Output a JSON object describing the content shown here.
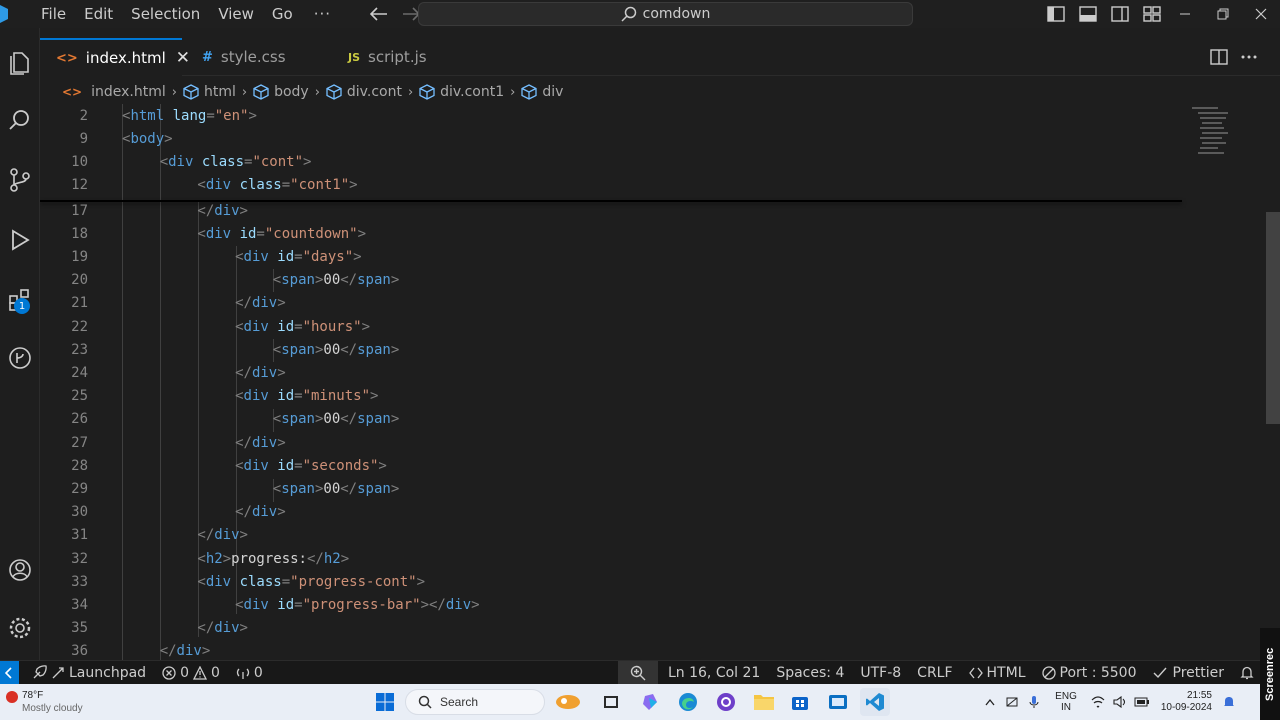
{
  "titlebar": {
    "menu": [
      "File",
      "Edit",
      "Selection",
      "View",
      "Go"
    ],
    "more": "···",
    "command_center": "comdown"
  },
  "tabs": [
    {
      "label": "index.html",
      "icon": "<>",
      "active": true
    },
    {
      "label": "style.css",
      "icon": "#",
      "active": false
    },
    {
      "label": "script.js",
      "icon": "JS",
      "active": false
    }
  ],
  "breadcrumb": [
    "index.html",
    "html",
    "body",
    "div.cont",
    "div.cont1",
    "div"
  ],
  "activity_badge": "1",
  "editor": {
    "sticky": [
      {
        "n": "2",
        "indent": 0,
        "code": [
          [
            "br",
            "<"
          ],
          [
            "tag",
            "html"
          ],
          [
            "txt",
            " "
          ],
          [
            "attr",
            "lang"
          ],
          [
            "br",
            "="
          ],
          [
            "str",
            "\"en\""
          ],
          [
            "br",
            ">"
          ]
        ]
      },
      {
        "n": "9",
        "indent": 0,
        "code": [
          [
            "br",
            "<"
          ],
          [
            "tag",
            "body"
          ],
          [
            "br",
            ">"
          ]
        ]
      },
      {
        "n": "10",
        "indent": 1,
        "code": [
          [
            "br",
            "<"
          ],
          [
            "tag",
            "div"
          ],
          [
            "txt",
            " "
          ],
          [
            "attr",
            "class"
          ],
          [
            "br",
            "="
          ],
          [
            "str",
            "\"cont\""
          ],
          [
            "br",
            ">"
          ]
        ]
      },
      {
        "n": "12",
        "indent": 2,
        "code": [
          [
            "br",
            "<"
          ],
          [
            "tag",
            "div"
          ],
          [
            "txt",
            " "
          ],
          [
            "attr",
            "class"
          ],
          [
            "br",
            "="
          ],
          [
            "str",
            "\"cont1\""
          ],
          [
            "br",
            ">"
          ]
        ]
      }
    ],
    "lines": [
      {
        "n": "17",
        "indent": 2,
        "code": [
          [
            "br",
            "</"
          ],
          [
            "tag",
            "div"
          ],
          [
            "br",
            ">"
          ]
        ]
      },
      {
        "n": "18",
        "indent": 2,
        "code": [
          [
            "br",
            "<"
          ],
          [
            "tag",
            "div"
          ],
          [
            "txt",
            " "
          ],
          [
            "attr",
            "id"
          ],
          [
            "br",
            "="
          ],
          [
            "str",
            "\"countdown\""
          ],
          [
            "br",
            ">"
          ]
        ]
      },
      {
        "n": "19",
        "indent": 3,
        "code": [
          [
            "br",
            "<"
          ],
          [
            "tag",
            "div"
          ],
          [
            "txt",
            " "
          ],
          [
            "attr",
            "id"
          ],
          [
            "br",
            "="
          ],
          [
            "str",
            "\"days\""
          ],
          [
            "br",
            ">"
          ]
        ]
      },
      {
        "n": "20",
        "indent": 4,
        "code": [
          [
            "br",
            "<"
          ],
          [
            "tag",
            "span"
          ],
          [
            "br",
            ">"
          ],
          [
            "txt",
            "00"
          ],
          [
            "br",
            "</"
          ],
          [
            "tag",
            "span"
          ],
          [
            "br",
            ">"
          ]
        ]
      },
      {
        "n": "21",
        "indent": 3,
        "code": [
          [
            "br",
            "</"
          ],
          [
            "tag",
            "div"
          ],
          [
            "br",
            ">"
          ]
        ]
      },
      {
        "n": "22",
        "indent": 3,
        "code": [
          [
            "br",
            "<"
          ],
          [
            "tag",
            "div"
          ],
          [
            "txt",
            " "
          ],
          [
            "attr",
            "id"
          ],
          [
            "br",
            "="
          ],
          [
            "str",
            "\"hours\""
          ],
          [
            "br",
            ">"
          ]
        ]
      },
      {
        "n": "23",
        "indent": 4,
        "code": [
          [
            "br",
            "<"
          ],
          [
            "tag",
            "span"
          ],
          [
            "br",
            ">"
          ],
          [
            "txt",
            "00"
          ],
          [
            "br",
            "</"
          ],
          [
            "tag",
            "span"
          ],
          [
            "br",
            ">"
          ]
        ]
      },
      {
        "n": "24",
        "indent": 3,
        "code": [
          [
            "br",
            "</"
          ],
          [
            "tag",
            "div"
          ],
          [
            "br",
            ">"
          ]
        ]
      },
      {
        "n": "25",
        "indent": 3,
        "code": [
          [
            "br",
            "<"
          ],
          [
            "tag",
            "div"
          ],
          [
            "txt",
            " "
          ],
          [
            "attr",
            "id"
          ],
          [
            "br",
            "="
          ],
          [
            "str",
            "\"minuts\""
          ],
          [
            "br",
            ">"
          ]
        ]
      },
      {
        "n": "26",
        "indent": 4,
        "code": [
          [
            "br",
            "<"
          ],
          [
            "tag",
            "span"
          ],
          [
            "br",
            ">"
          ],
          [
            "txt",
            "00"
          ],
          [
            "br",
            "</"
          ],
          [
            "tag",
            "span"
          ],
          [
            "br",
            ">"
          ]
        ]
      },
      {
        "n": "27",
        "indent": 3,
        "code": [
          [
            "br",
            "</"
          ],
          [
            "tag",
            "div"
          ],
          [
            "br",
            ">"
          ]
        ]
      },
      {
        "n": "28",
        "indent": 3,
        "code": [
          [
            "br",
            "<"
          ],
          [
            "tag",
            "div"
          ],
          [
            "txt",
            " "
          ],
          [
            "attr",
            "id"
          ],
          [
            "br",
            "="
          ],
          [
            "str",
            "\"seconds\""
          ],
          [
            "br",
            ">"
          ]
        ]
      },
      {
        "n": "29",
        "indent": 4,
        "code": [
          [
            "br",
            "<"
          ],
          [
            "tag",
            "span"
          ],
          [
            "br",
            ">"
          ],
          [
            "txt",
            "00"
          ],
          [
            "br",
            "</"
          ],
          [
            "tag",
            "span"
          ],
          [
            "br",
            ">"
          ]
        ]
      },
      {
        "n": "30",
        "indent": 3,
        "code": [
          [
            "br",
            "</"
          ],
          [
            "tag",
            "div"
          ],
          [
            "br",
            ">"
          ]
        ]
      },
      {
        "n": "31",
        "indent": 2,
        "code": [
          [
            "br",
            "</"
          ],
          [
            "tag",
            "div"
          ],
          [
            "br",
            ">"
          ]
        ]
      },
      {
        "n": "32",
        "indent": 2,
        "code": [
          [
            "br",
            "<"
          ],
          [
            "tag",
            "h2"
          ],
          [
            "br",
            ">"
          ],
          [
            "txt",
            "progress:"
          ],
          [
            "br",
            "</"
          ],
          [
            "tag",
            "h2"
          ],
          [
            "br",
            ">"
          ]
        ]
      },
      {
        "n": "33",
        "indent": 2,
        "code": [
          [
            "br",
            "<"
          ],
          [
            "tag",
            "div"
          ],
          [
            "txt",
            " "
          ],
          [
            "attr",
            "class"
          ],
          [
            "br",
            "="
          ],
          [
            "str",
            "\"progress-cont\""
          ],
          [
            "br",
            ">"
          ]
        ]
      },
      {
        "n": "34",
        "indent": 3,
        "code": [
          [
            "br",
            "<"
          ],
          [
            "tag",
            "div"
          ],
          [
            "txt",
            " "
          ],
          [
            "attr",
            "id"
          ],
          [
            "br",
            "="
          ],
          [
            "str",
            "\"progress-bar\""
          ],
          [
            "br",
            "></"
          ],
          [
            "tag",
            "div"
          ],
          [
            "br",
            ">"
          ]
        ]
      },
      {
        "n": "35",
        "indent": 2,
        "code": [
          [
            "br",
            "</"
          ],
          [
            "tag",
            "div"
          ],
          [
            "br",
            ">"
          ]
        ]
      },
      {
        "n": "36",
        "indent": 1,
        "code": [
          [
            "br",
            "</"
          ],
          [
            "tag",
            "div"
          ],
          [
            "br",
            ">"
          ]
        ]
      }
    ]
  },
  "statusbar": {
    "launchpad": "Launchpad",
    "errors": "0",
    "warnings": "0",
    "ports": "0",
    "position": "Ln 16, Col 21",
    "spaces": "Spaces: 4",
    "encoding": "UTF-8",
    "eol": "CRLF",
    "language": "HTML",
    "port": "Port : 5500",
    "prettier": "Prettier"
  },
  "taskbar": {
    "temp": "78°F",
    "weather": "Mostly cloudy",
    "search": "Search",
    "lang_top": "ENG",
    "lang_bottom": "IN",
    "time": "21:55",
    "date": "10-09-2024"
  },
  "watermark": "Screenrec",
  "colors": {
    "accent": "#0078d4",
    "tag": "#569cd6",
    "attr": "#9cdcfe",
    "string": "#ce9178"
  }
}
